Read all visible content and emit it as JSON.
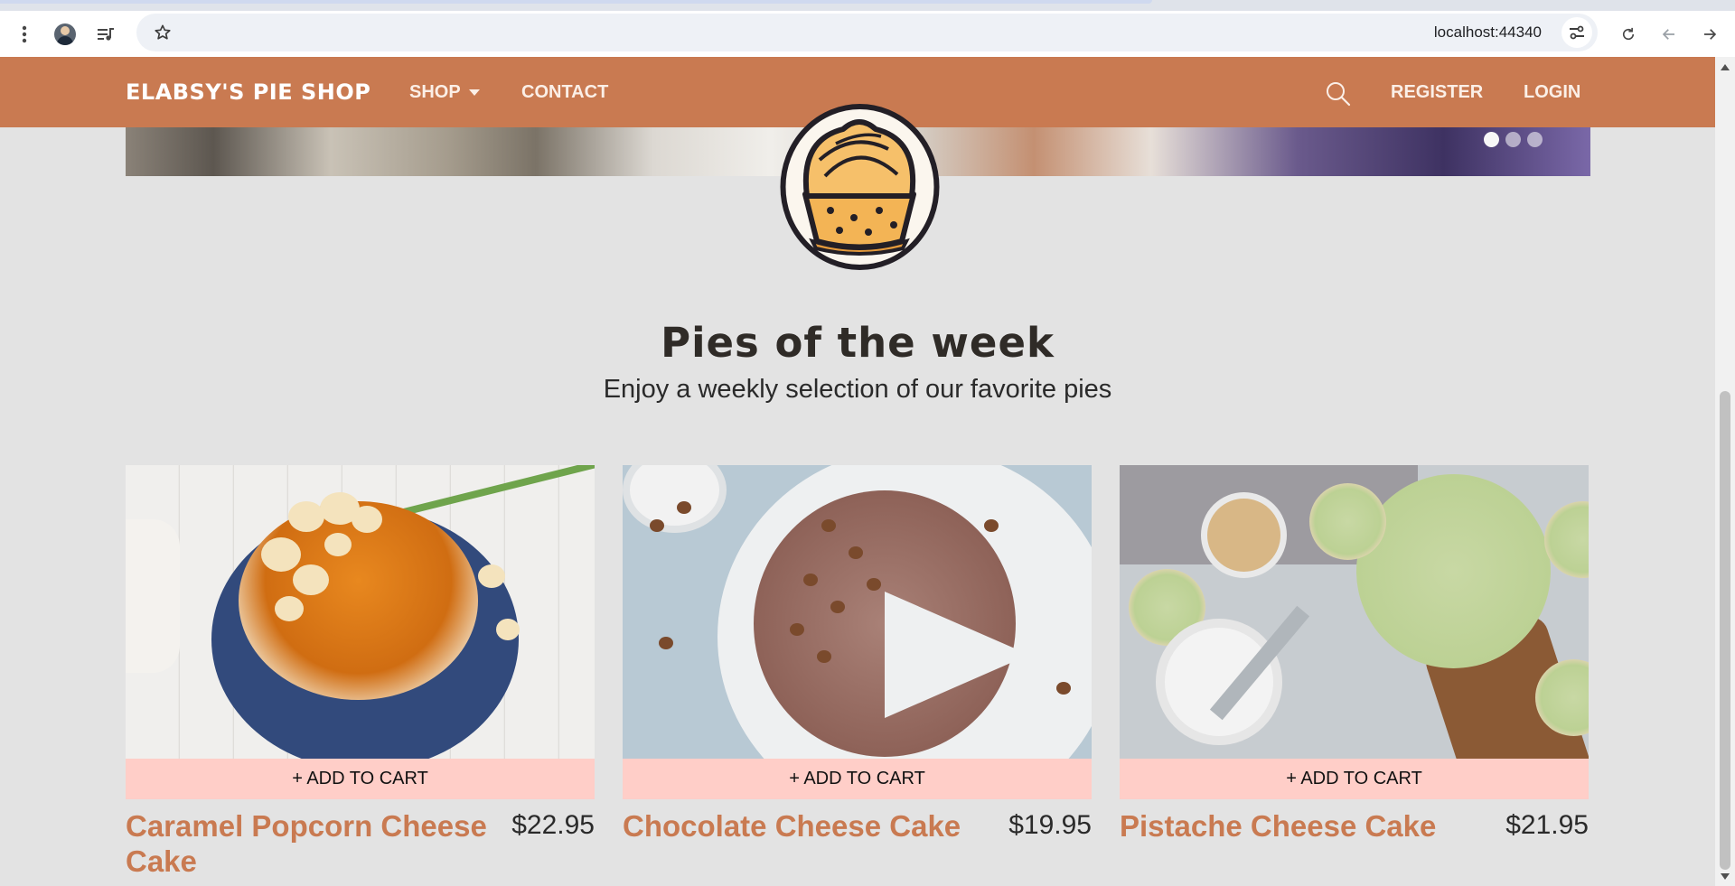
{
  "browser": {
    "url": "localhost:44340"
  },
  "nav": {
    "brand": "ELABSY'S PIE SHOP",
    "shop": "SHOP",
    "contact": "CONTACT",
    "register": "REGISTER",
    "login": "LOGIN"
  },
  "carousel": {
    "slide_count": 3,
    "active_slide": 1
  },
  "section": {
    "title": "Pies of the week",
    "subtitle": "Enjoy a weekly selection of our favorite pies"
  },
  "pies": [
    {
      "name": "Caramel Popcorn Cheese Cake",
      "price": "$22.95",
      "cart_label": "+ ADD TO CART"
    },
    {
      "name": "Chocolate Cheese Cake",
      "price": "$19.95",
      "cart_label": "+ ADD TO CART"
    },
    {
      "name": "Pistache Cheese Cake",
      "price": "$21.95",
      "cart_label": "+ ADD TO CART"
    }
  ],
  "colors": {
    "brand": "#c97a51",
    "page_bg": "#e3e3e3",
    "cart_button": "#ffcec8"
  },
  "icons": {
    "menu": "kebab-menu-icon",
    "profile": "avatar",
    "media": "media-controls-icon",
    "bookmark": "star-icon",
    "site_info": "tune-icon",
    "reload": "reload-icon",
    "back": "back-arrow-icon",
    "forward": "forward-arrow-icon",
    "search": "search-icon"
  }
}
